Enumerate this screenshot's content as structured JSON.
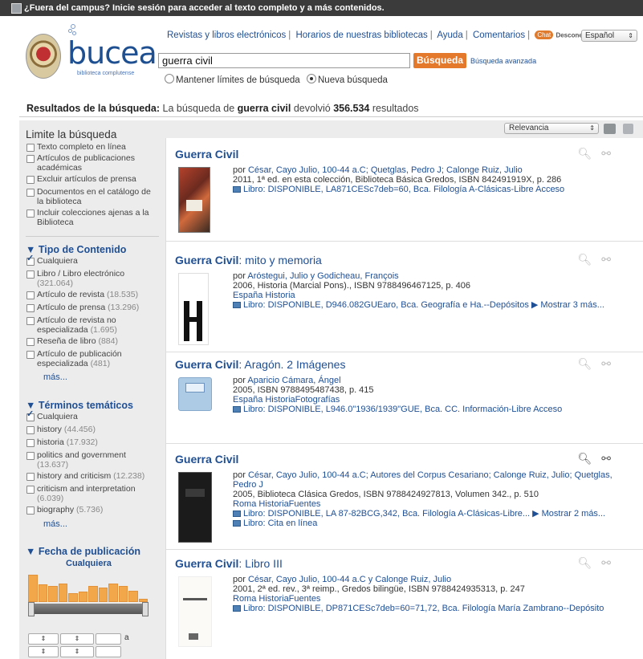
{
  "topbar": {
    "text": "¿Fuera del campus? Inicie sesión para acceder al texto completo y a más contenidos."
  },
  "logo": {
    "name": "bucea",
    "subtitle": "biblioteca complutense"
  },
  "toplinks": {
    "items": [
      "Revistas y libros electrónicos",
      "Horarios de nuestras bibliotecas",
      "Ayuda",
      "Comentarios"
    ],
    "chat": "Chat",
    "status": "Desconectado",
    "language": "Español"
  },
  "search": {
    "value": "guerra civil",
    "button": "Búsqueda",
    "advanced": "Búsqueda avanzada",
    "options": [
      "Mantener límites de búsqueda",
      "Nueva búsqueda"
    ]
  },
  "results_summary": {
    "label": "Resultados de la búsqueda:",
    "pre": "La búsqueda de",
    "term": "guerra civil",
    "mid": "devolvió",
    "count": "356.534",
    "post": "resultados"
  },
  "sidebar": {
    "heading": "Limite la búsqueda",
    "limits": [
      "Texto completo en línea",
      "Artículos de publicaciones académicas",
      "Excluir artículos de prensa",
      "Documentos en el catálogo de la biblioteca",
      "Incluir colecciones ajenas a la Biblioteca"
    ],
    "content_type": {
      "title": "Tipo de Contenido",
      "selected": "Cualquiera",
      "items": [
        {
          "label": "Libro / Libro electrónico",
          "count": "(321.064)"
        },
        {
          "label": "Artículo de revista",
          "count": "(18.535)"
        },
        {
          "label": "Artículo de prensa",
          "count": "(13.296)"
        },
        {
          "label": "Artículo de revista no especializada",
          "count": "(1.695)"
        },
        {
          "label": "Reseña de libro",
          "count": "(884)"
        },
        {
          "label": "Artículo de publicación especializada",
          "count": "(481)"
        }
      ],
      "more": "más..."
    },
    "subjects": {
      "title": "Términos temáticos",
      "selected": "Cualquiera",
      "items": [
        {
          "label": "history",
          "count": "(44.456)"
        },
        {
          "label": "historia",
          "count": "(17.932)"
        },
        {
          "label": "politics and government",
          "count": "(13.637)"
        },
        {
          "label": "history and criticism",
          "count": "(12.238)"
        },
        {
          "label": "criticism and interpretation",
          "count": "(6.039)"
        },
        {
          "label": "biography",
          "count": "(5.736)"
        }
      ],
      "more": "más..."
    },
    "date": {
      "title": "Fecha de publicación",
      "selected": "Cualquiera",
      "histogram": [
        0.95,
        0.6,
        0.55,
        0.65,
        0.3,
        0.35,
        0.55,
        0.5,
        0.65,
        0.55,
        0.4,
        0.1
      ],
      "range_sep": "a"
    }
  },
  "toolbar": {
    "sort": "Relevancia"
  },
  "results": [
    {
      "title_bold": "Guerra Civil",
      "title_rest": "",
      "authors": "César, Cayo Julio, 100-44 a.C; Quetglas, Pedro J; Calonge Ruiz, Julio",
      "by": "por",
      "details": "2011, 1ª ed. en esta colección, Biblioteca Básica Gredos, ISBN 842491919X, p. 286",
      "subjects": "",
      "holdings": "Libro: DISPONIBLE, LA871CESc7deb=60, Bca. Filología A-Clásicas-Libre Acceso",
      "holdings2": "",
      "more": ""
    },
    {
      "title_bold": "Guerra Civil",
      "title_rest": ": mito y memoria",
      "authors": "Aróstegui, Julio y Godicheau, François",
      "by": "por",
      "details": "2006, Historia (Marcial Pons)., ISBN 9788496467125, p. 406",
      "subjects": "España Historia",
      "holdings": "Libro: DISPONIBLE, D946.082GUEaro, Bca. Geografía e Ha.--Depósitos",
      "holdings2": "",
      "more": "▶ Mostrar 3 más..."
    },
    {
      "title_bold": "Guerra Civil",
      "title_rest": ": Aragón. 2 Imágenes",
      "authors": "Aparicio Cámara, Ángel",
      "by": "por",
      "details": "2005, ISBN 9788495487438, p. 415",
      "subjects": "España HistoriaFotografías",
      "holdings": "Libro: DISPONIBLE, L946.0\"1936/1939\"GUE, Bca. CC. Información-Libre Acceso",
      "holdings2": "",
      "more": ""
    },
    {
      "title_bold": "Guerra Civil",
      "title_rest": "",
      "authors": "César, Cayo Julio, 100-44 a.C; Autores del Corpus Cesariano; Calonge Ruiz, Julio; Quetglas, Pedro J",
      "by": "por",
      "details": "2005, Biblioteca Clásica Gredos, ISBN 9788424927813, Volumen 342., p. 510",
      "subjects": "Roma HistoriaFuentes",
      "holdings": "Libro: DISPONIBLE, LA 87-82BCG,342, Bca. Filología A-Clásicas-Libre...",
      "holdings2": "Libro: Cita en línea",
      "more": "▶ Mostrar 2 más..."
    },
    {
      "title_bold": "Guerra Civil",
      "title_rest": ": Libro III",
      "authors": "César, Cayo Julio, 100-44 a.C y Calonge Ruiz, Julio",
      "by": "por",
      "details": "2001, 2ª ed. rev., 3ª reimp., Gredos bilingüe, ISBN 9788424935313, p. 247",
      "subjects": "Roma HistoriaFuentes",
      "holdings": "Libro: DISPONIBLE, DP871CESc7deb=60=71,72, Bca. Filología María Zambrano--Depósito",
      "holdings2": "",
      "more": ""
    }
  ]
}
